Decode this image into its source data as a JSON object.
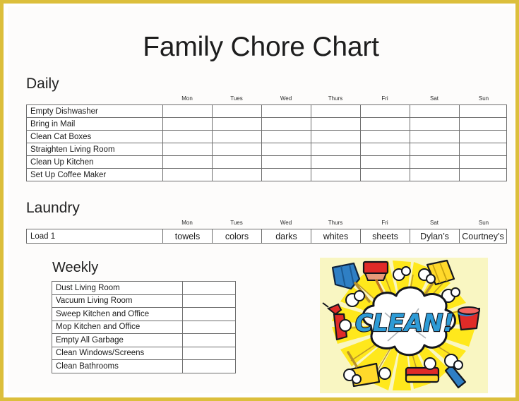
{
  "document": {
    "title": "Family Chore Chart",
    "border_color": "#dcbf3c",
    "page_background": "#fdfcfb"
  },
  "daily": {
    "heading": "Daily",
    "days": [
      "Mon",
      "Tues",
      "Wed",
      "Thurs",
      "Fri",
      "Sat",
      "Sun"
    ],
    "chores": [
      "Empty Dishwasher",
      "Bring in Mail",
      "Clean Cat Boxes",
      "Straighten Living Room",
      "Clean Up Kitchen",
      "Set Up Coffee Maker"
    ]
  },
  "laundry": {
    "heading": "Laundry",
    "days": [
      "Mon",
      "Tues",
      "Wed",
      "Thurs",
      "Fri",
      "Sat",
      "Sun"
    ],
    "rows": [
      {
        "label": "Load 1",
        "values": [
          "towels",
          "colors",
          "darks",
          "whites",
          "sheets",
          "Dylan’s",
          "Courtney’s"
        ]
      }
    ]
  },
  "weekly": {
    "heading": "Weekly",
    "chores": [
      "Dust Living Room",
      "Vacuum Living Room",
      "Sweep Kitchen and Office",
      "Mop Kitchen and Office",
      "Empty All Garbage",
      "Clean Windows/Screens",
      "Clean Bathrooms"
    ]
  },
  "clipart": {
    "name": "clean-burst-clipart",
    "word": "CLEAN!",
    "background_color": "#f9f6c2",
    "burst_color": "#ffe81c",
    "word_color": "#2e9bd6",
    "cloud_color": "#ffffff",
    "tools": [
      "mop",
      "brush",
      "broom",
      "spray-bottle",
      "bucket",
      "sponge",
      "dustpan",
      "squeegee"
    ]
  }
}
